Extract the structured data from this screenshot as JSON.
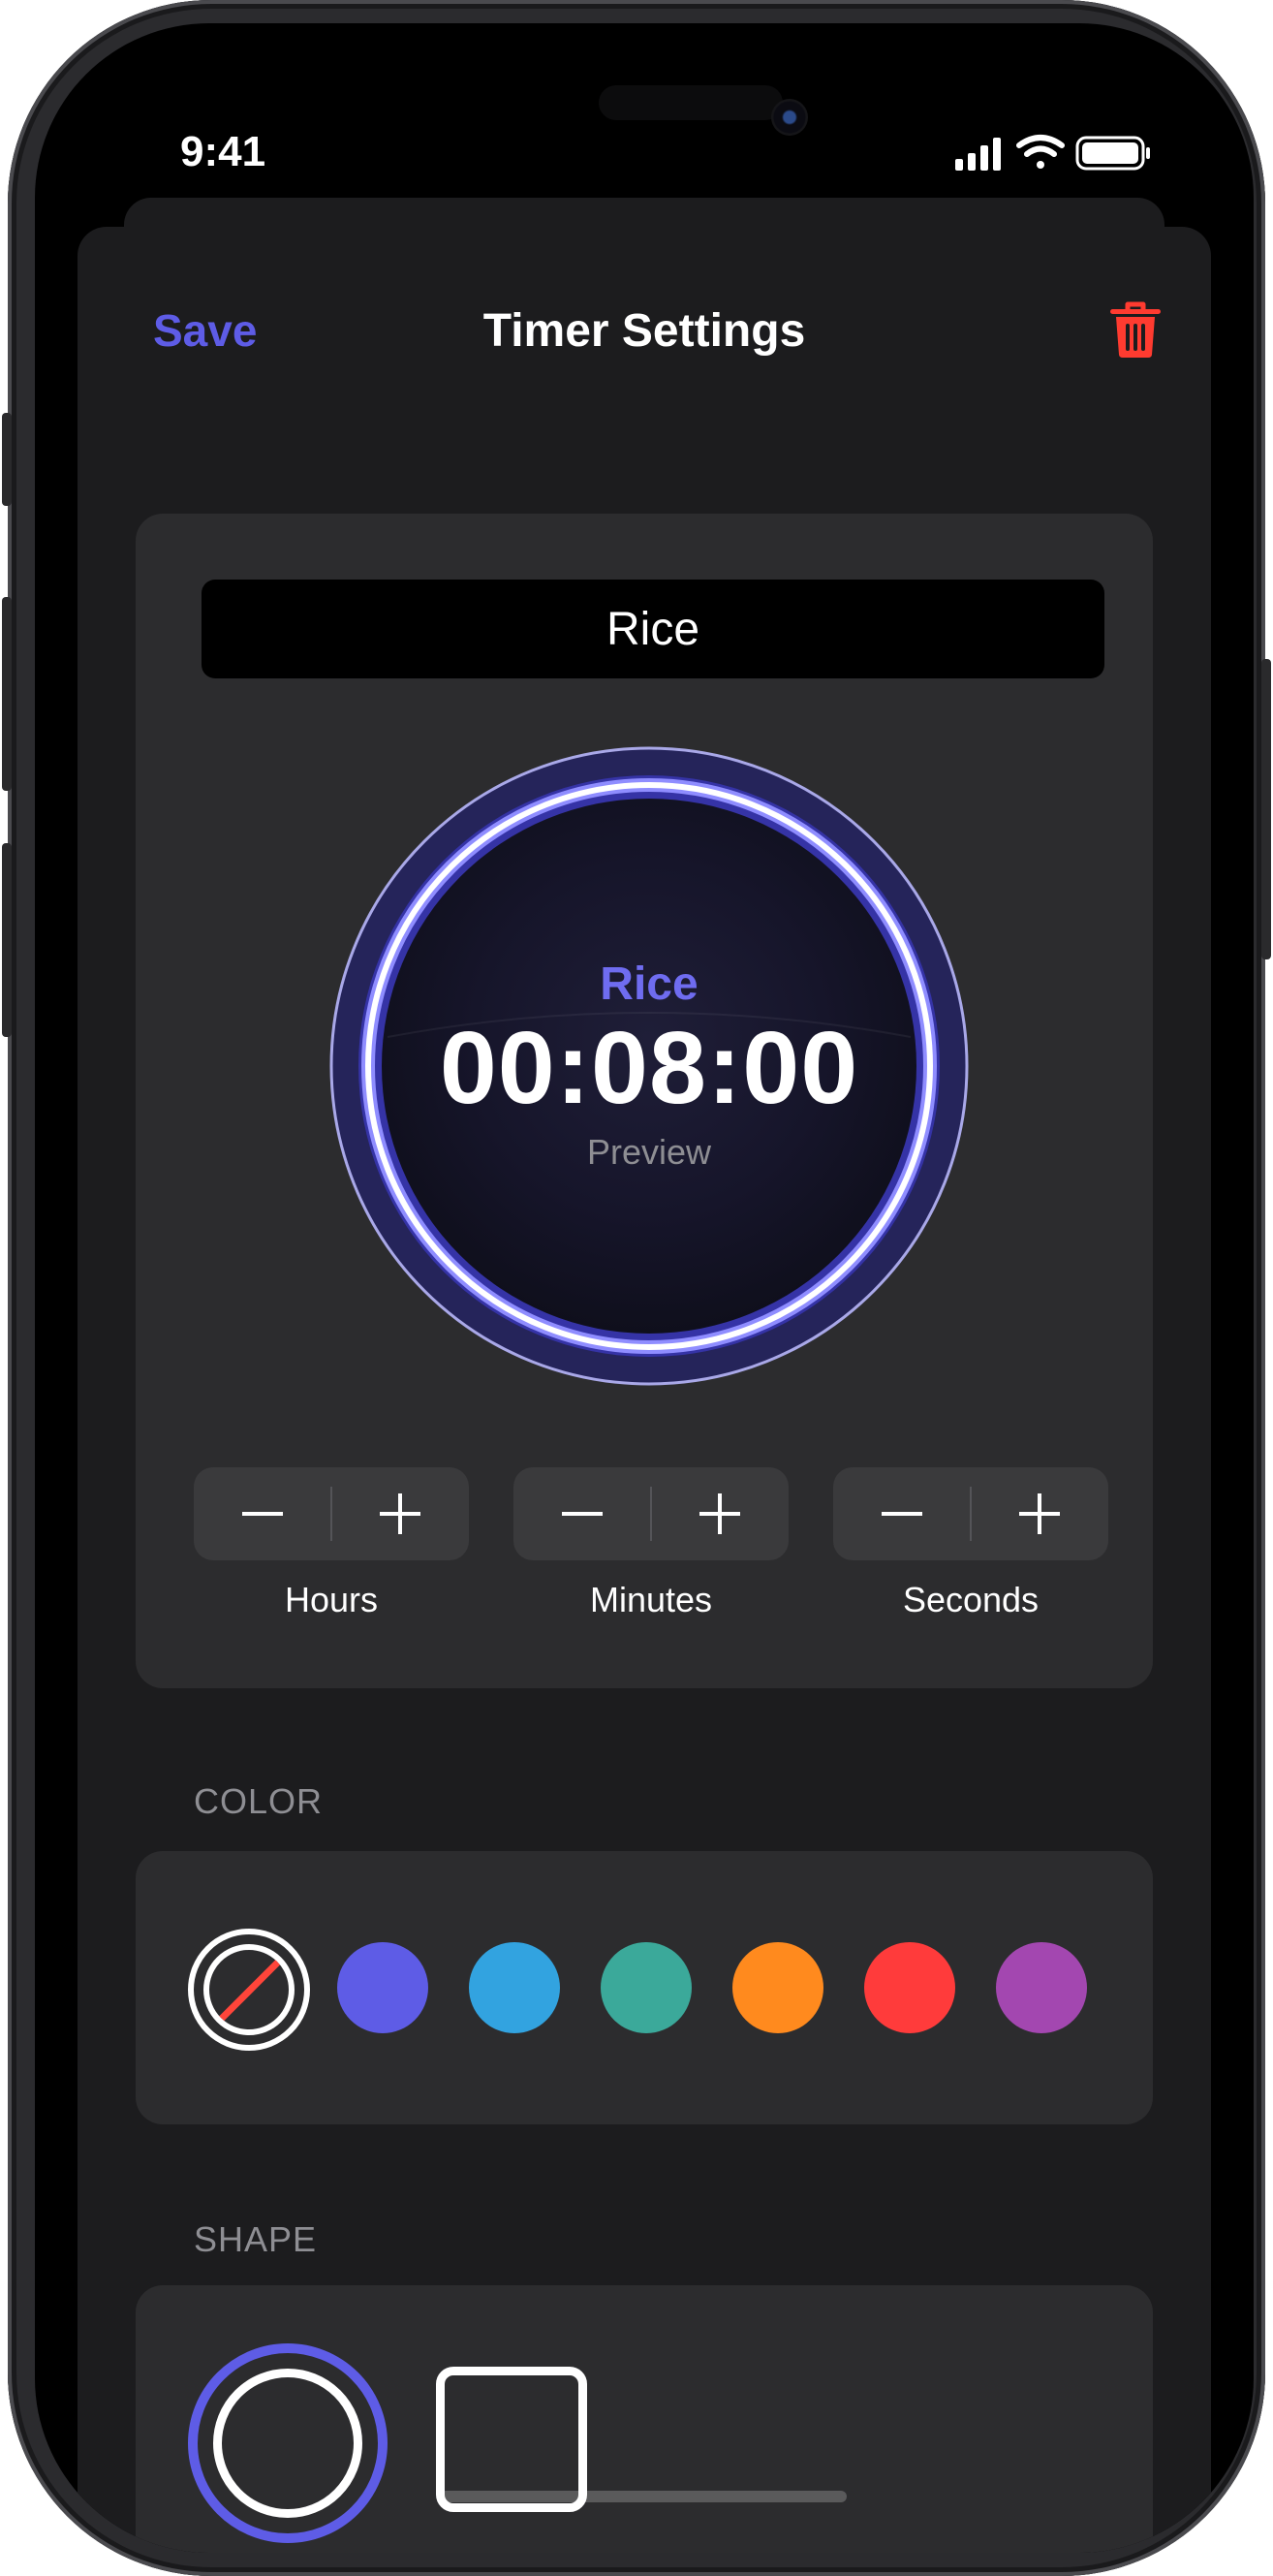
{
  "status_bar": {
    "time": "9:41"
  },
  "nav": {
    "save_label": "Save",
    "title": "Timer Settings"
  },
  "timer": {
    "name": "Rice",
    "preview_name": "Rice",
    "preview_time": "00:08:00",
    "preview_label": "Preview",
    "accent_color": "#5e5ce6"
  },
  "steppers": [
    {
      "label": "Hours"
    },
    {
      "label": "Minutes"
    },
    {
      "label": "Seconds"
    }
  ],
  "color_section": {
    "header": "COLOR",
    "swatches": [
      {
        "name": "none",
        "selected": true
      },
      {
        "name": "indigo",
        "hex": "#5e5ce6"
      },
      {
        "name": "blue",
        "hex": "#32a3e0"
      },
      {
        "name": "teal",
        "hex": "#3ba99a"
      },
      {
        "name": "orange",
        "hex": "#ff8a1e"
      },
      {
        "name": "red",
        "hex": "#ff3b3b"
      },
      {
        "name": "purple",
        "hex": "#a347b0"
      }
    ]
  },
  "shape_section": {
    "header": "SHAPE",
    "options": [
      {
        "name": "circle",
        "selected": true
      },
      {
        "name": "square",
        "selected": false
      }
    ]
  }
}
